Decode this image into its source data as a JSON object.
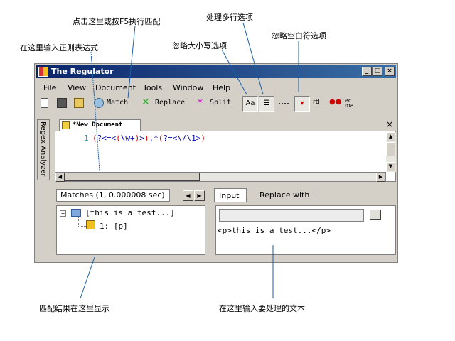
{
  "annotations": {
    "click_match": "点击这里或按F5执行匹配",
    "multiline": "处理多行选项",
    "ignore_whitespace": "忽略空白符选项",
    "ignore_case": "忽略大小写选项",
    "enter_regex": "在这里输入正则表达式",
    "match_results": "匹配结果在这里显示",
    "enter_text": "在这里输入要处理的文本"
  },
  "window": {
    "title": "The Regulator",
    "controls": {
      "minimize": "_",
      "maximize": "□",
      "close": "×"
    }
  },
  "menu": {
    "file": "File",
    "view": "View",
    "document": "Document",
    "tools": "Tools",
    "window": "Window",
    "help": "Help"
  },
  "toolbar": {
    "match": "Match",
    "replace": "Replace",
    "split": "Split",
    "ignore_case_label": "Aa"
  },
  "sidebar": {
    "tab": "Regex Analyzer"
  },
  "document": {
    "tab_label": "*New Document",
    "line_number": "1",
    "regex": "(?<=<(\\w+)>).*(?=<\\/\\1>)",
    "close": "×"
  },
  "matches": {
    "tab_label": "Matches (1, 0.000008 sec)",
    "root": "[this is a test...]",
    "item": "1: [p]"
  },
  "right_panel": {
    "tabs": [
      "Input",
      "Replace with"
    ],
    "input_text": "<p>this is a test...</p>"
  },
  "colors": {
    "titlebar": "#0a246a",
    "window_bg": "#d4d0c8",
    "regex_red": "#cc0000",
    "regex_blue": "#0000aa",
    "annotation_line": "#1a5fa8"
  }
}
